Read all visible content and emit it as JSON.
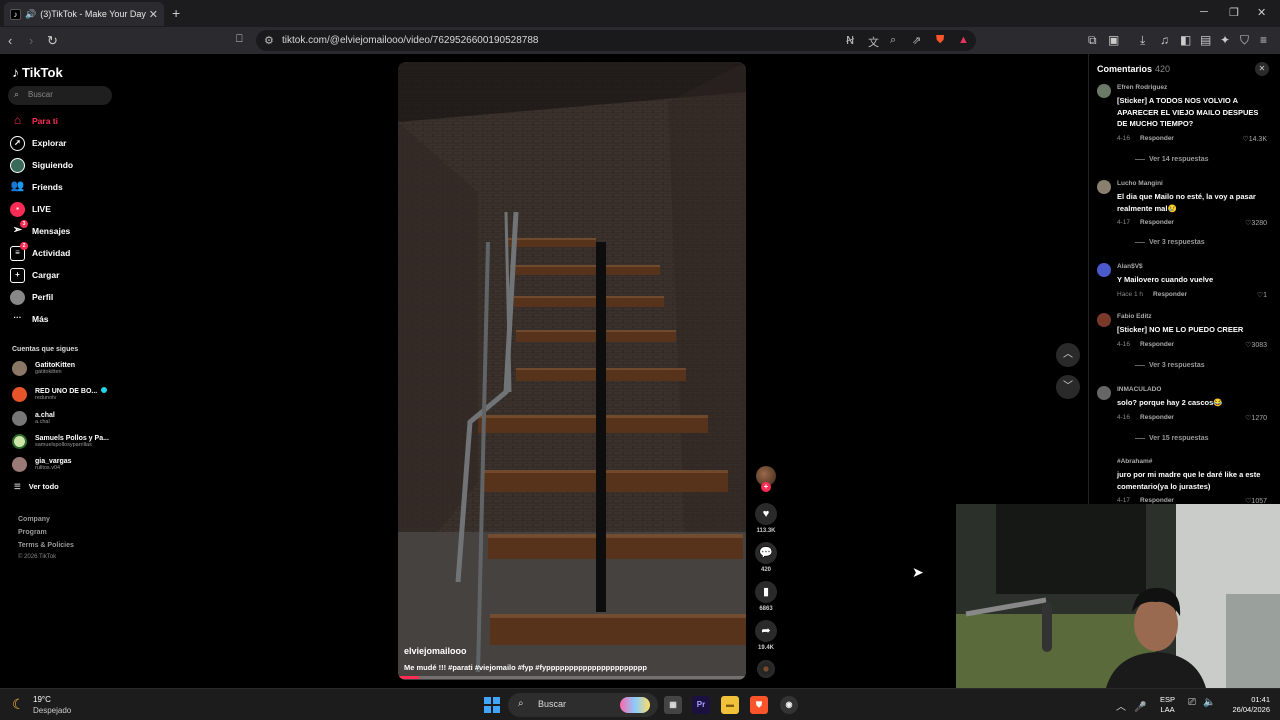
{
  "browser": {
    "tab_title": "(3)TikTok - Make Your Day",
    "url": "tiktok.com/@elviejomailooo/video/7629526600190528788"
  },
  "sidebar": {
    "logo": "TikTok",
    "search_placeholder": "Buscar",
    "nav": [
      {
        "label": "Para ti"
      },
      {
        "label": "Explorar"
      },
      {
        "label": "Siguiendo"
      },
      {
        "label": "Friends"
      },
      {
        "label": "LIVE"
      },
      {
        "label": "Mensajes",
        "badge": "3"
      },
      {
        "label": "Actividad",
        "badge": "2"
      },
      {
        "label": "Cargar"
      },
      {
        "label": "Perfil"
      },
      {
        "label": "Más"
      }
    ],
    "following_title": "Cuentas que sigues",
    "accounts": [
      {
        "name": "GatitoKitten",
        "handle": "gatitokitten"
      },
      {
        "name": "RED UNO DE BO...",
        "handle": "redunotv"
      },
      {
        "name": "a.chal",
        "handle": "a.chal"
      },
      {
        "name": "Samuels Pollos y Pa...",
        "handle": "samuelspollosyparrillas"
      },
      {
        "name": "gia_vargas",
        "handle": "rulitos.v04"
      }
    ],
    "see_all": "Ver todo",
    "footer": [
      "Company",
      "Program",
      "Terms & Policies"
    ],
    "copyright": "© 2026 TikTok"
  },
  "video": {
    "author": "elviejomailooo",
    "caption": "Me mudé !!! #parati #viejomailo #fyp #fypppppppppppppppppppppp",
    "progress": 0.06
  },
  "actions": {
    "likes": "113.3K",
    "comments": "420",
    "saves": "6863",
    "shares": "19.4K"
  },
  "comments": {
    "title": "Comentarios",
    "count": "420",
    "items": [
      {
        "user": "Efren Rodriguez",
        "text": "[Sticker] A TODOS NOS VOLVIO A APARECER EL VIEJO MAILO DESPUES DE MUCHO TIEMPO?",
        "date": "4-16",
        "reply": "Responder",
        "likes": "14.3K",
        "replies": "Ver 14 respuestas"
      },
      {
        "user": "Lucho Mangini",
        "text": "El dia que Mailo no esté, la voy a pasar realmente mal😢",
        "date": "4-17",
        "reply": "Responder",
        "likes": "3280",
        "replies": "Ver 3 respuestas"
      },
      {
        "user": "Alan$V$",
        "text": "Y Mailovero cuando vuelve",
        "date": "Hace 1 h",
        "reply": "Responder",
        "likes": "1",
        "replies": ""
      },
      {
        "user": "Fabio Editz",
        "text": "[Sticker] NO ME LO PUEDO CREER",
        "date": "4-16",
        "reply": "Responder",
        "likes": "3083",
        "replies": "Ver 3 respuestas"
      },
      {
        "user": "INMACULADO",
        "text": "solo? porque hay 2 cascos😂",
        "date": "4-16",
        "reply": "Responder",
        "likes": "1270",
        "replies": "Ver 15 respuestas"
      },
      {
        "user": "#Abraham#",
        "text": "juro por mi madre que le daré like a este comentario(ya lo jurastes)",
        "date": "4-17",
        "reply": "Responder",
        "likes": "1057",
        "replies": ""
      }
    ]
  },
  "taskbar": {
    "temp": "19°C",
    "condition": "Despejado",
    "search": "Buscar",
    "lang1": "ESP",
    "lang2": "LAA",
    "time": "01:41",
    "date": "26/04/2026"
  },
  "colors": {
    "accent": "#fe2c55",
    "live": "#20d5ec"
  }
}
